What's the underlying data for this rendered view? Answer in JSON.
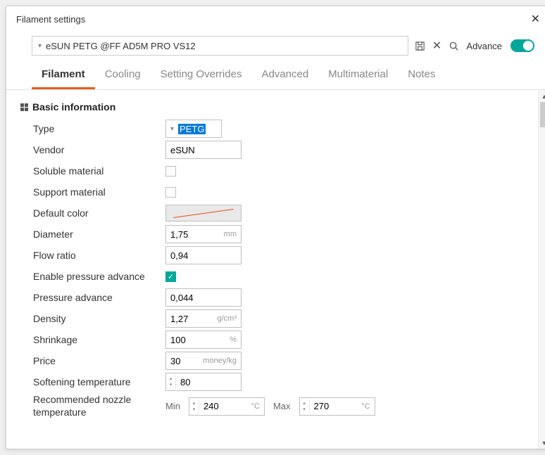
{
  "window": {
    "title": "Filament settings"
  },
  "toolbar": {
    "preset": "eSUN PETG @FF AD5M PRO VS12",
    "advance": "Advance"
  },
  "tabs": [
    "Filament",
    "Cooling",
    "Setting Overrides",
    "Advanced",
    "Multimaterial",
    "Notes"
  ],
  "section": {
    "basic": "Basic information"
  },
  "fields": {
    "type": {
      "label": "Type",
      "value": "PETG"
    },
    "vendor": {
      "label": "Vendor",
      "value": "eSUN"
    },
    "soluble": {
      "label": "Soluble material"
    },
    "support": {
      "label": "Support material"
    },
    "default_color": {
      "label": "Default color"
    },
    "diameter": {
      "label": "Diameter",
      "value": "1,75",
      "unit": "mm"
    },
    "flow_ratio": {
      "label": "Flow ratio",
      "value": "0,94"
    },
    "epa": {
      "label": "Enable pressure advance"
    },
    "pa": {
      "label": "Pressure advance",
      "value": "0,044"
    },
    "density": {
      "label": "Density",
      "value": "1,27",
      "unit": "g/cm³"
    },
    "shrinkage": {
      "label": "Shrinkage",
      "value": "100",
      "unit": "%"
    },
    "price": {
      "label": "Price",
      "value": "30",
      "unit": "money/kg"
    },
    "soft_temp": {
      "label": "Softening temperature",
      "value": "80"
    },
    "nozzle": {
      "label": "Recommended nozzle temperature",
      "min_label": "Min",
      "min": "240",
      "max_label": "Max",
      "max": "270",
      "unit": "°C"
    }
  }
}
